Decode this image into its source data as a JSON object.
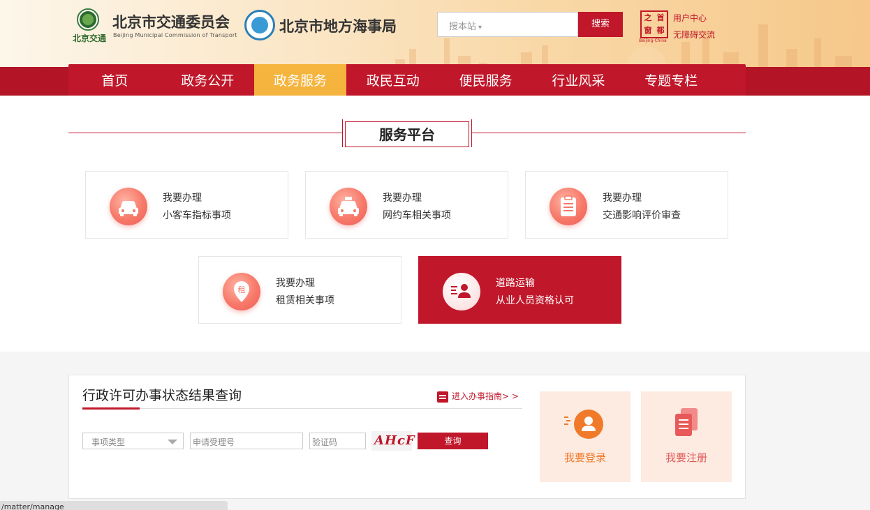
{
  "header": {
    "org1_name": "北京市交通委员会",
    "org1_en": "Beijing Municipal Commission of Transport",
    "org1_logo_text": "北京交通",
    "org2_name": "北京市地方海事局",
    "search": {
      "placeholder": "搜本站",
      "button": "搜索"
    },
    "seal_chars": [
      "之",
      "首",
      "窗",
      "都"
    ],
    "seal_sub": "Beijing-China",
    "user_center": "用户中心",
    "accessibility": "无障碍交流"
  },
  "nav": {
    "items": [
      {
        "label": "首页",
        "active": false
      },
      {
        "label": "政务公开",
        "active": false
      },
      {
        "label": "政务服务",
        "active": true
      },
      {
        "label": "政民互动",
        "active": false
      },
      {
        "label": "便民服务",
        "active": false
      },
      {
        "label": "行业风采",
        "active": false
      },
      {
        "label": "专题专栏",
        "active": false
      }
    ]
  },
  "services": {
    "title": "服务平台",
    "cards": [
      {
        "line1": "我要办理",
        "line2": "小客车指标事项",
        "icon": "car-icon"
      },
      {
        "line1": "我要办理",
        "line2": "网约车相关事项",
        "icon": "taxi-icon"
      },
      {
        "line1": "我要办理",
        "line2": "交通影响评价审查",
        "icon": "clipboard-icon"
      },
      {
        "line1": "我要办理",
        "line2": "租赁相关事项",
        "icon": "rent-icon",
        "icon_char": "租"
      },
      {
        "line1": "道路运输",
        "line2": "从业人员资格认可",
        "icon": "person-card-icon"
      }
    ]
  },
  "query": {
    "title": "行政许可办事状态结果查询",
    "guide_link": "进入办事指南> >",
    "type_placeholder": "事项类型",
    "number_placeholder": "申请受理号",
    "captcha_placeholder": "验证码",
    "captcha_text": "AHcF",
    "submit": "查询"
  },
  "tiles": {
    "login": "我要登录",
    "register": "我要注册"
  },
  "status_bar": "/matter/manage"
}
